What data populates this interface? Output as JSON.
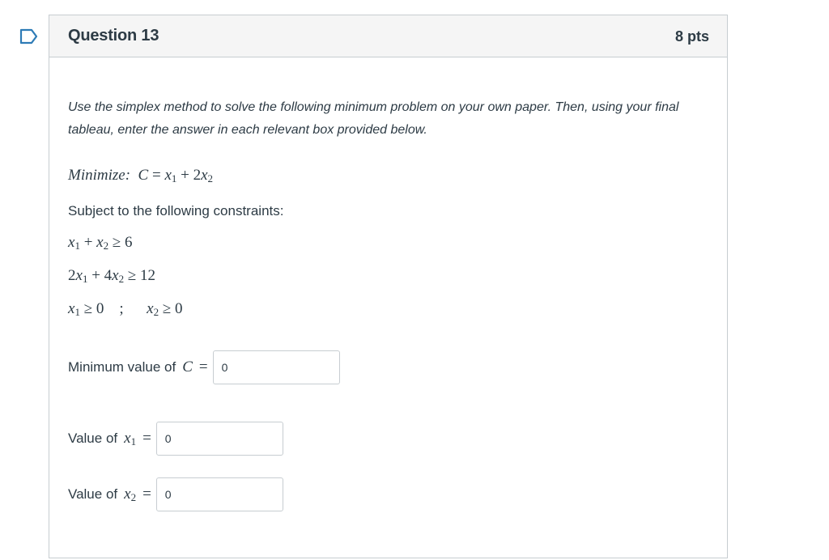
{
  "question": {
    "title": "Question 13",
    "points": "8 pts",
    "instructions": "Use the simplex method to solve the following minimum problem on your own paper. Then, using your final tableau, enter the answer in each relevant box provided below.",
    "objective_label": "Minimize:",
    "constraints_heading": "Subject to the following constraints:",
    "answers": {
      "min_c_label": "Minimum value of",
      "min_c_value": "0",
      "x1_label": "Value of",
      "x1_value": "0",
      "x2_label": "Value of",
      "x2_value": "0"
    }
  },
  "icons": {
    "flag": "bookmark-flag-icon"
  },
  "colors": {
    "flag": "#2d7bb6",
    "border": "#c7cdd1",
    "header_bg": "#f5f5f5",
    "text": "#2d3b45"
  }
}
